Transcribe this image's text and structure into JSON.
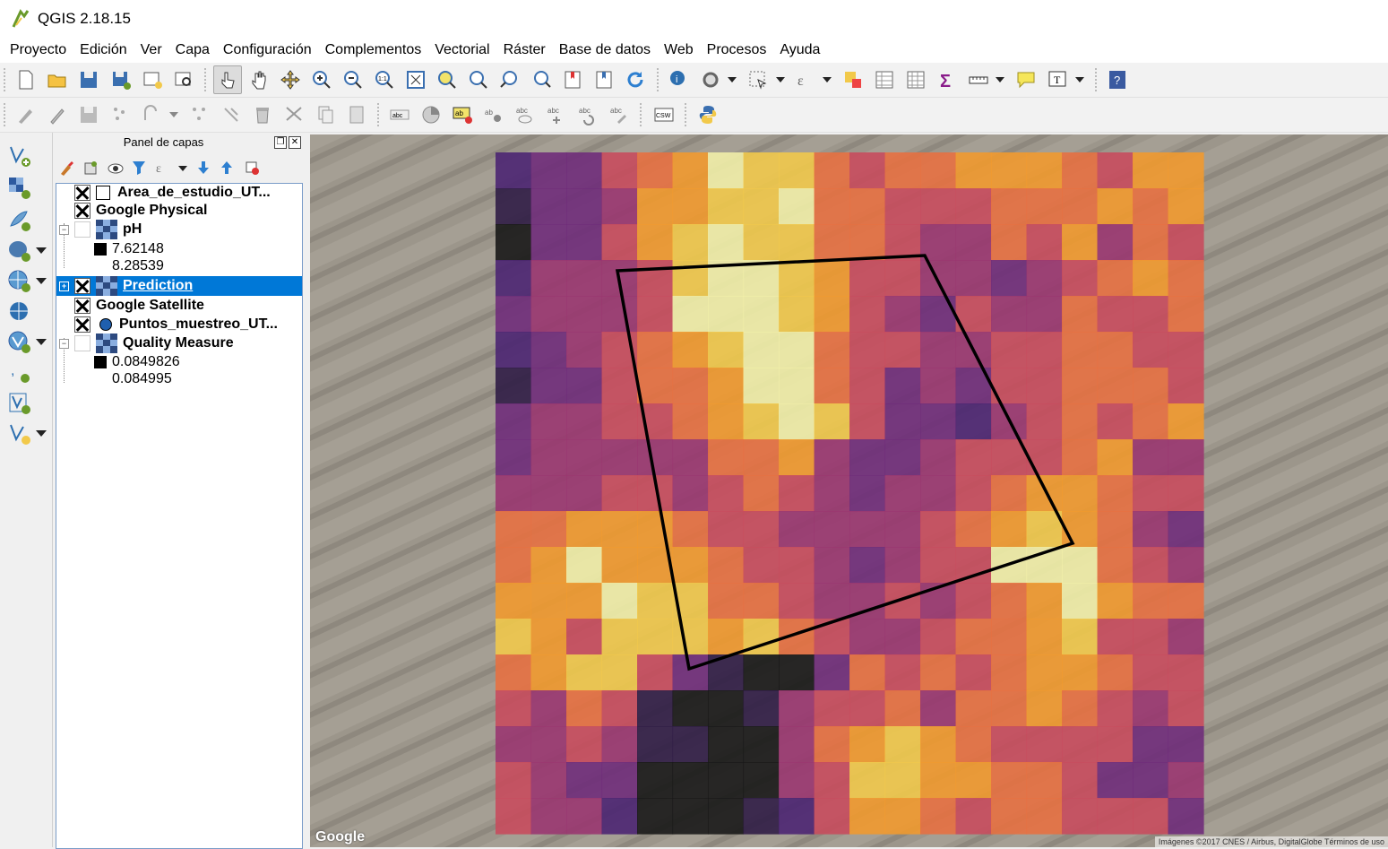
{
  "window": {
    "title": "QGIS 2.18.15"
  },
  "menu": [
    "Proyecto",
    "Edición",
    "Ver",
    "Capa",
    "Configuración",
    "Complementos",
    "Vectorial",
    "Ráster",
    "Base de datos",
    "Web",
    "Procesos",
    "Ayuda"
  ],
  "panel": {
    "title": "Panel de capas"
  },
  "layers": [
    {
      "name": "Area_de_estudio_UT...",
      "checked": true,
      "type": "polygon-layer-icon"
    },
    {
      "name": "Google Physical",
      "checked": true,
      "type": "none"
    },
    {
      "name": "pH",
      "checked": false,
      "type": "raster-layer-icon",
      "legend": [
        "7.62148",
        "8.28539"
      ]
    },
    {
      "name": "Prediction",
      "checked": true,
      "type": "raster-layer-icon",
      "selected": true
    },
    {
      "name": "Google Satellite",
      "checked": true,
      "type": "none"
    },
    {
      "name": "Puntos_muestreo_UT...",
      "checked": true,
      "type": "point-layer-icon"
    },
    {
      "name": "Quality Measure",
      "checked": false,
      "type": "raster-layer-icon",
      "legend": [
        "0.0849826",
        "0.084995"
      ]
    }
  ],
  "map": {
    "google_label": "Google",
    "credits": "Imágenes ©2017 CNES / Airbus, DigitalGlobe   Términos de uso",
    "raster": {
      "cols": 20,
      "rows": 19,
      "palette": [
        "#161616",
        "#2d1a44",
        "#4a2272",
        "#6e2a7a",
        "#9a3470",
        "#c84a5c",
        "#e87040",
        "#f39a2c",
        "#f2c94a",
        "#f2f0a8"
      ],
      "cells": [
        "23356798865667776577",
        "13347788966555666767",
        "03357898866544657465",
        "24445899875544345676",
        "34445999875435446556",
        "23456789965544556655",
        "13356679965343556665",
        "34455678985332456567",
        "34444466743345556744",
        "44455456543445677655",
        "66777655444456787643",
        "67977765543455999654",
        "77798866544545679766",
        "87588878654456678554",
        "67885310036565677655",
        "54651001455646676545",
        "44541100467876555533",
        "54330000458877665334",
        "54420001257765665553"
      ]
    },
    "study_area_polygon": "polygon-outline"
  },
  "colors": {
    "selection": "#0078d7",
    "accent": "#f2c94a"
  }
}
